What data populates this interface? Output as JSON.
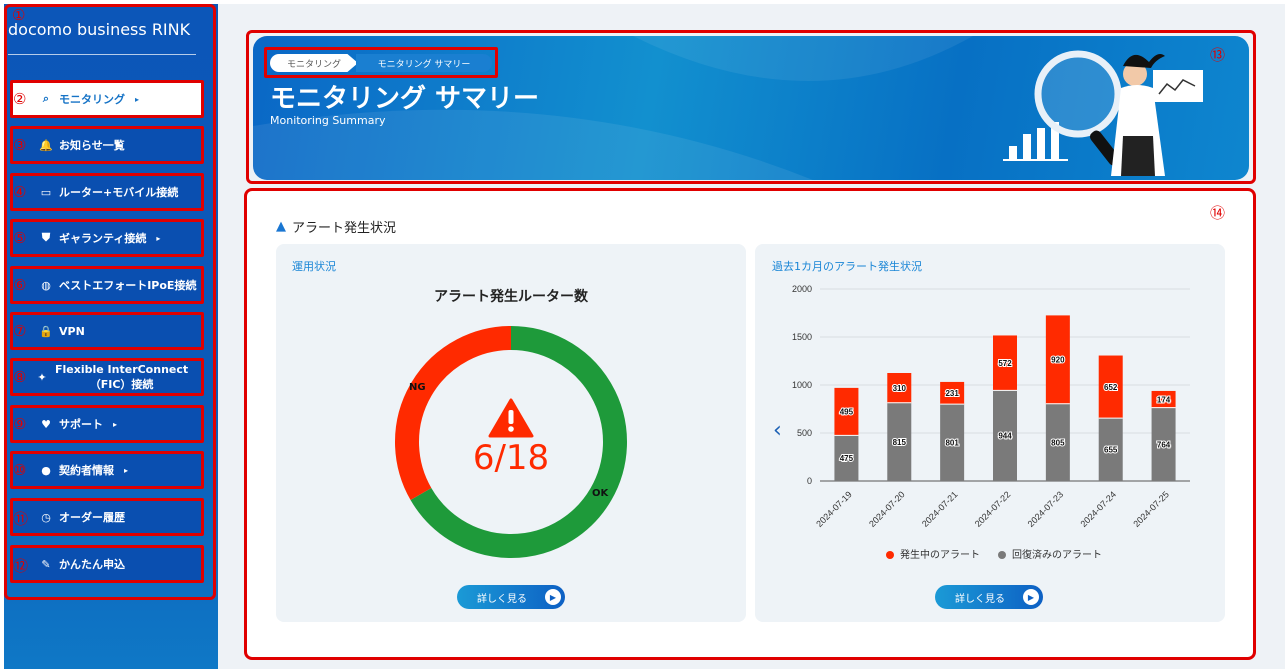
{
  "sidebar": {
    "logo": "docomo business RINK",
    "items": [
      {
        "num": "②",
        "label": "モニタリング",
        "icon": "monitor-search-icon",
        "arrow": "▸"
      },
      {
        "num": "③",
        "label": "お知らせ一覧",
        "icon": "bell-icon"
      },
      {
        "num": "④",
        "label": "ルーター+モバイル接続",
        "icon": "router-icon"
      },
      {
        "num": "⑤",
        "label": "ギャランティ接続",
        "icon": "shield-icon",
        "arrow": "▸"
      },
      {
        "num": "⑥",
        "label": "ベストエフォートIPoE接続",
        "icon": "globe-icon"
      },
      {
        "num": "⑦",
        "label": "VPN",
        "icon": "lock-icon"
      },
      {
        "num": "⑧",
        "label": "Flexible InterConnect",
        "label2": "（FIC）接続",
        "icon": "satellite-icon"
      },
      {
        "num": "⑨",
        "label": "サポート",
        "icon": "support-icon",
        "arrow": "▸"
      },
      {
        "num": "⑩",
        "label": "契約者情報",
        "icon": "user-icon",
        "arrow": "▸"
      },
      {
        "num": "⑪",
        "label": "オーダー履歴",
        "icon": "clock-icon"
      },
      {
        "num": "⑫",
        "label": "かんたん申込",
        "icon": "edit-icon"
      }
    ],
    "num1": "①"
  },
  "banner": {
    "breadcrumb1": "モニタリング",
    "breadcrumb2": "モニタリング サマリー",
    "title": "モニタリング サマリー",
    "subtitle": "Monitoring Summary",
    "num": "⑬"
  },
  "content": {
    "num": "⑭",
    "section_title": "アラート発生状況",
    "left_label": "運用状況",
    "donut_title": "アラート発生ルーター数",
    "donut_value": "6/18",
    "ng_label": "NG",
    "ok_label": "OK",
    "right_label": "過去1カ月のアラート発生状況",
    "detail_button": "詳しく見る",
    "legend_active": "発生中のアラート",
    "legend_recovered": "回復済みのアラート"
  },
  "colors": {
    "alert": "#ff2a00",
    "ok": "#1e9a3a",
    "recovered": "#7a7a7a",
    "accent": "#1a86d6"
  },
  "donut_data": {
    "ng": 6,
    "total": 18
  },
  "chart_data": {
    "type": "bar",
    "stacked": true,
    "categories": [
      "2024-07-19",
      "2024-07-20",
      "2024-07-21",
      "2024-07-22",
      "2024-07-23",
      "2024-07-24",
      "2024-07-25"
    ],
    "series": [
      {
        "name": "回復済みのアラート",
        "values": [
          475,
          815,
          801,
          944,
          805,
          655,
          764
        ],
        "color": "#7a7a7a"
      },
      {
        "name": "発生中のアラート",
        "values": [
          495,
          310,
          231,
          572,
          920,
          652,
          174
        ],
        "color": "#ff2a00"
      }
    ],
    "yticks": [
      0,
      500,
      1000,
      1500,
      2000
    ],
    "ylim": [
      0,
      2000
    ],
    "legend_position": "bottom"
  }
}
